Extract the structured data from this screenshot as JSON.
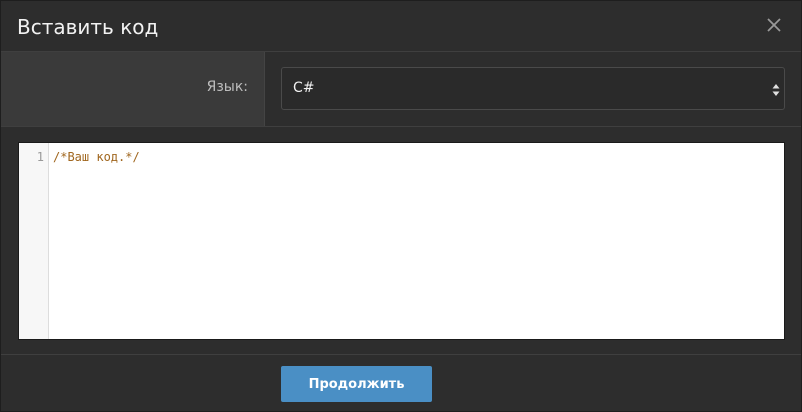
{
  "dialog": {
    "title": "Вставить код",
    "close_icon": "close-icon"
  },
  "language": {
    "label": "Язык:",
    "selected": "C#",
    "arrow_icon": "select-arrows-icon"
  },
  "editor": {
    "lines": [
      {
        "number": "1",
        "text": "/*Ваш код.*/"
      }
    ]
  },
  "footer": {
    "continue_label": "Продолжить"
  },
  "colors": {
    "background": "#2d2d2d",
    "label_cell": "#3a3a3a",
    "button": "#4a8fc5",
    "comment": "#a0661e"
  }
}
